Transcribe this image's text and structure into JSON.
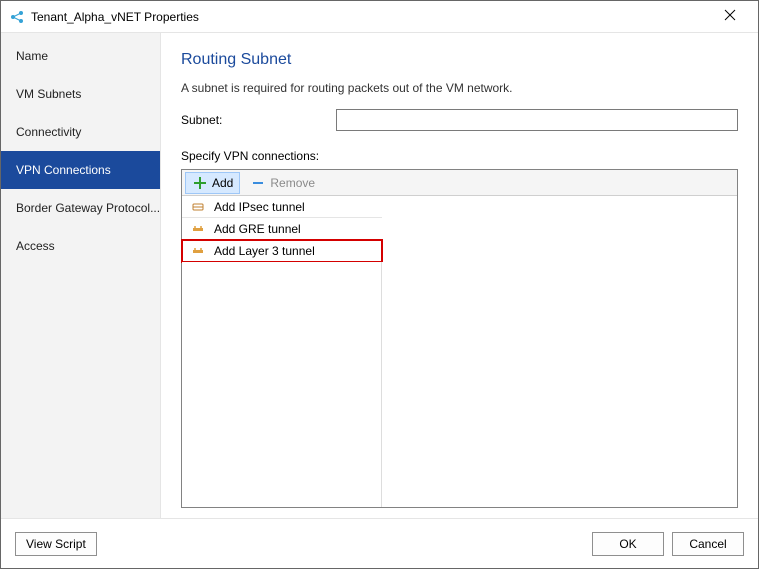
{
  "window": {
    "title": "Tenant_Alpha_vNET Properties"
  },
  "sidebar": {
    "items": [
      {
        "label": "Name"
      },
      {
        "label": "VM Subnets"
      },
      {
        "label": "Connectivity"
      },
      {
        "label": "VPN Connections"
      },
      {
        "label": "Border Gateway Protocol..."
      },
      {
        "label": "Access"
      }
    ],
    "selected_index": 3
  },
  "main": {
    "heading": "Routing Subnet",
    "description": "A subnet is required for routing packets out of the VM network.",
    "subnet_label": "Subnet:",
    "subnet_value": "",
    "specify_label": "Specify VPN connections:",
    "toolbar": {
      "add_label": "Add",
      "remove_label": "Remove"
    },
    "add_menu": {
      "items": [
        {
          "label": "Add IPsec tunnel"
        },
        {
          "label": "Add GRE tunnel"
        },
        {
          "label": "Add Layer 3 tunnel"
        }
      ],
      "highlighted_index": 2
    }
  },
  "footer": {
    "view_script_label": "View Script",
    "ok_label": "OK",
    "cancel_label": "Cancel"
  }
}
